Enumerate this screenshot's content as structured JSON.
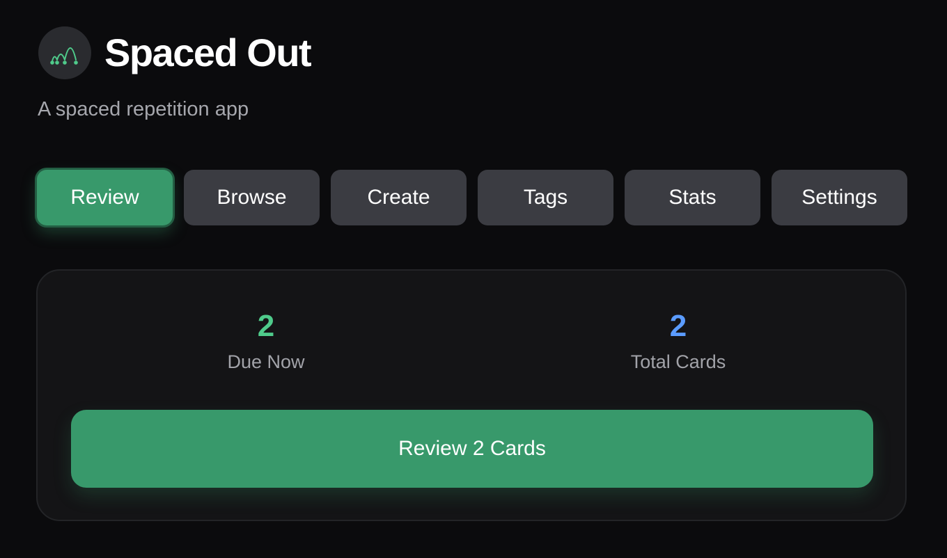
{
  "app": {
    "title": "Spaced Out",
    "subtitle": "A spaced repetition app",
    "logo_icon": "spaced-arcs-logo-icon"
  },
  "nav": {
    "active": "Review",
    "tabs": [
      {
        "label": "Review"
      },
      {
        "label": "Browse"
      },
      {
        "label": "Create"
      },
      {
        "label": "Tags"
      },
      {
        "label": "Stats"
      },
      {
        "label": "Settings"
      }
    ]
  },
  "review_panel": {
    "due": {
      "value": "2",
      "label": "Due Now",
      "color": "#4fcb8b"
    },
    "total": {
      "value": "2",
      "label": "Total Cards",
      "color": "#5b9cff"
    },
    "button_label": "Review 2 Cards"
  },
  "colors": {
    "accent": "#38996b",
    "background": "#0b0b0d",
    "tab_inactive": "#3b3c42",
    "panel": "#141416"
  }
}
